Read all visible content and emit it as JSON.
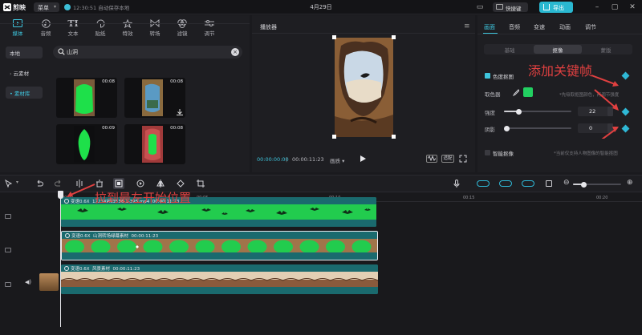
{
  "titlebar": {
    "app_name": "剪映",
    "menu_label": "菜单",
    "autosave_text": "12:30:51 自动保存本地",
    "doc_title": "4月29日",
    "shortcut_label": "快捷键",
    "export_label": "导出"
  },
  "media": {
    "tabs": [
      {
        "label": "媒体",
        "icon": "media-icon"
      },
      {
        "label": "音频",
        "icon": "audio-icon"
      },
      {
        "label": "文本",
        "icon": "text-icon"
      },
      {
        "label": "贴纸",
        "icon": "sticker-icon"
      },
      {
        "label": "特效",
        "icon": "effects-icon"
      },
      {
        "label": "转场",
        "icon": "transition-icon"
      },
      {
        "label": "滤镜",
        "icon": "filter-icon"
      },
      {
        "label": "调节",
        "icon": "adjust-icon"
      }
    ],
    "sidebar": [
      {
        "label": "本地",
        "prefix": ""
      },
      {
        "label": "云素材",
        "prefix": "›"
      },
      {
        "label": "素材库",
        "prefix": "•"
      }
    ],
    "search_query": "山洞",
    "thumbnails": [
      {
        "duration": "00:08"
      },
      {
        "duration": "00:08"
      },
      {
        "duration": "00:09"
      },
      {
        "duration": "00:08"
      }
    ]
  },
  "player": {
    "title": "播放器",
    "current_time": "00:00:00:00",
    "total_time": "00:00:11:23",
    "quality": "画质",
    "btn_ratio": "原始",
    "btn_fit": "适配"
  },
  "props": {
    "tabs": [
      "画面",
      "音频",
      "变速",
      "动画",
      "调节"
    ],
    "subtabs": [
      "基础",
      "抠像",
      "蒙版"
    ],
    "chroma_label": "色度抠图",
    "picker_label": "取色器",
    "picker_hint": "*先吸取抠图颜色，再调节强度",
    "intensity_label": "强度",
    "intensity_value": "22",
    "intensity_level": 0.22,
    "shadow_label": "阴影",
    "shadow_value": "0",
    "shadow_level": 0,
    "smart_label": "智能抠像",
    "smart_hint": "*当前仅支持人物图像的智能抠图",
    "key_color": "#22d061"
  },
  "annotations": {
    "keyframe_note": "添加关键帧",
    "drag_note": "拉到最左开始位置"
  },
  "timeline": {
    "ruler": [
      "00:00",
      "00:05",
      "00:10",
      "00:15",
      "00:20"
    ],
    "clips": [
      {
        "speed": "变速0.6X",
        "name": "1225XPN3536-1-395.mp4",
        "duration": "00:00:11:23"
      },
      {
        "speed": "变速0.6X",
        "name": "山洞转场绿幕素材",
        "duration": "00:00:11:23"
      },
      {
        "speed": "变速0.6X",
        "name": "风景素材",
        "duration": "00:00:11:23"
      }
    ]
  },
  "colors": {
    "accent": "#3ec5dd",
    "green_screen": "#22d061",
    "annotation_red": "#e04040"
  }
}
